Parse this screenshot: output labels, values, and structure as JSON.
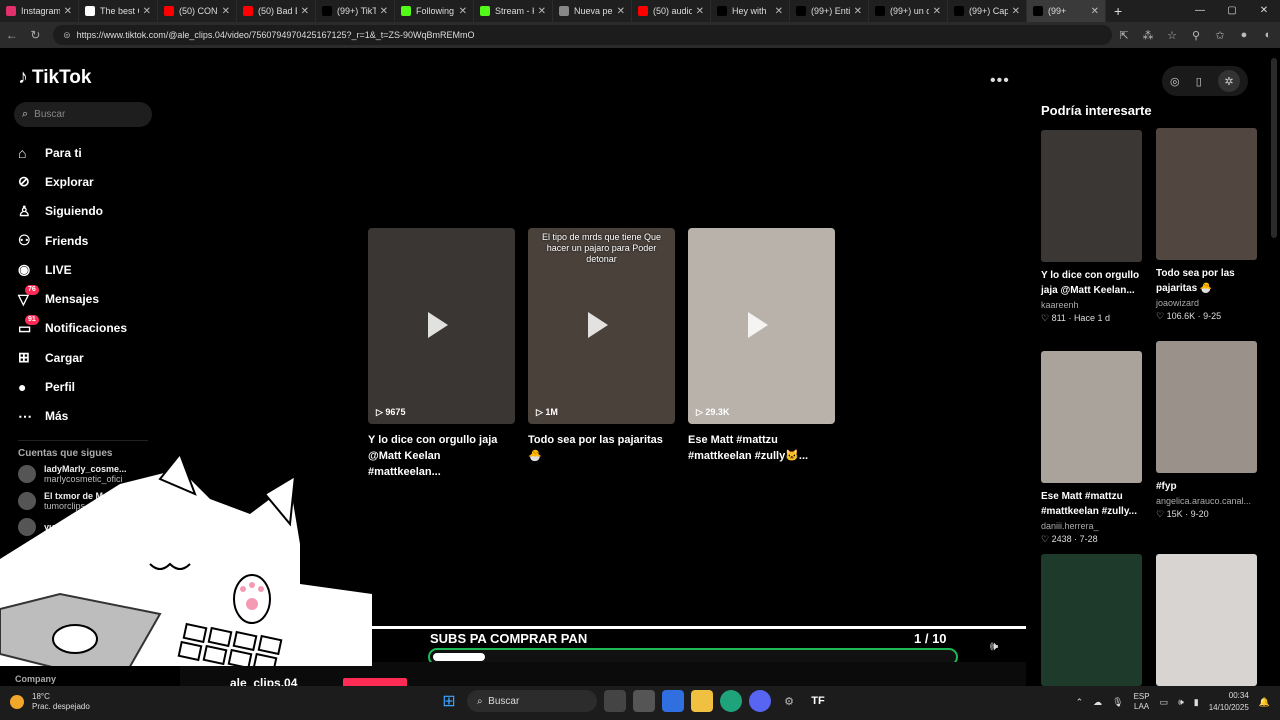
{
  "browser": {
    "tabs": [
      {
        "label": "Instagram",
        "color": "#e1306c"
      },
      {
        "label": "The best C",
        "color": "#ffffff"
      },
      {
        "label": "(50) CONC",
        "color": "#ff0000"
      },
      {
        "label": "(50) Bad B",
        "color": "#ff0000"
      },
      {
        "label": "(99+) TikTo",
        "color": "#000000"
      },
      {
        "label": "Following",
        "color": "#53fc18"
      },
      {
        "label": "Stream - K",
        "color": "#53fc18"
      },
      {
        "label": "Nueva pe",
        "color": "#888888"
      },
      {
        "label": "(50) audio",
        "color": "#ff0000"
      },
      {
        "label": "Hey with",
        "color": "#000000"
      },
      {
        "label": "(99+) Entie",
        "color": "#000000"
      },
      {
        "label": "(99+) un di",
        "color": "#000000"
      },
      {
        "label": "(99+) Capi",
        "color": "#000000"
      },
      {
        "label": "(99+",
        "color": "#000000"
      }
    ],
    "url": "https://www.tiktok.com/@ale_clips.04/video/7560794970425167125?_r=1&_t=ZS-90WqBmREMmO"
  },
  "app": {
    "logo": "TikTok",
    "search_placeholder": "Buscar",
    "nav": [
      {
        "label": "Para ti",
        "icon": "home-icon",
        "glyph": "⌂"
      },
      {
        "label": "Explorar",
        "icon": "compass-icon",
        "glyph": "⊘"
      },
      {
        "label": "Siguiendo",
        "icon": "user-follow-icon",
        "glyph": "♙"
      },
      {
        "label": "Friends",
        "icon": "friends-icon",
        "glyph": "⚇"
      },
      {
        "label": "LIVE",
        "icon": "live-icon",
        "glyph": "◉"
      },
      {
        "label": "Mensajes",
        "icon": "messages-icon",
        "glyph": "▽",
        "badge": "76"
      },
      {
        "label": "Notificaciones",
        "icon": "bell-icon",
        "glyph": "▭",
        "badge": "91"
      },
      {
        "label": "Cargar",
        "icon": "upload-icon",
        "glyph": "⊞"
      },
      {
        "label": "Perfil",
        "icon": "profile-icon",
        "glyph": "●"
      },
      {
        "label": "Más",
        "icon": "more-icon",
        "glyph": "⋯"
      }
    ],
    "following_heading": "Cuentas que sigues",
    "following": [
      {
        "name": "ladyMarly_cosme...",
        "handle": "marlycosmetic_ofici"
      },
      {
        "name": "El txmor de M",
        "handle": "tumorclips"
      },
      {
        "name": "yudit",
        "handle": ""
      }
    ],
    "company": "Company",
    "profile_name": "ale_clips.04"
  },
  "videos": [
    {
      "title": "Y lo dice con orgullo jaja\n@Matt Keelan #mattkeelan...",
      "views": "9675",
      "caption": "",
      "bg": "#3a3633"
    },
    {
      "title": "Todo sea por las pajaritas 🐣",
      "views": "1M",
      "caption": "El tipo de mrds que tiene\nQue hacer un pajaro para\nPoder detonar",
      "bg": "#4a413b"
    },
    {
      "title": "Ese Matt #mattzu\n#mattkeelan #zully🐱...",
      "views": "29.3K",
      "caption": "",
      "bg": "#b9b2aa"
    }
  ],
  "recommendations": {
    "heading": "Podría interesarte",
    "items": [
      {
        "title": "Y lo dice con orgullo\njaja @Matt Keelan...",
        "author": "kaareenh",
        "likes": "811",
        "date": "Hace 1 d",
        "bg": "#3b3735"
      },
      {
        "title": "Todo sea por las\npajaritas 🐣",
        "author": "joaowizard",
        "likes": "106.6K",
        "date": "9-25",
        "bg": "#514740"
      },
      {
        "title": "Ese Matt #mattzu\n#mattkeelan #zully...",
        "author": "daniii.herrera_",
        "likes": "2438",
        "date": "7-28",
        "bg": "#a9a39b"
      },
      {
        "title": "#fyp",
        "author": "angelica.arauco.canal...",
        "likes": "15K",
        "date": "9-20",
        "bg": "#9a928a"
      },
      {
        "title": "",
        "author": "",
        "likes": "",
        "date": "",
        "bg": "#1d3a2a"
      },
      {
        "title": "",
        "author": "",
        "likes": "",
        "date": "",
        "bg": "#d8d4d2"
      }
    ]
  },
  "overlay": {
    "title": "SUBS PA COMPRAR PAN",
    "count": "1   / 10",
    "progress": 0.1
  },
  "taskbar": {
    "temp": "18°C",
    "weather": "Prac. despejado",
    "search": "Buscar",
    "lang1": "ESP",
    "lang2": "LAA",
    "time": "00:34",
    "date": "14/10/2025"
  }
}
